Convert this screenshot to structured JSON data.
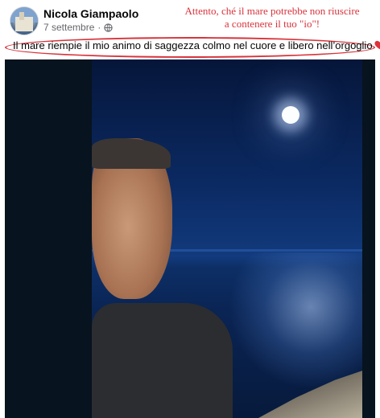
{
  "post": {
    "author": "Nicola Giampaolo",
    "date": "7 settembre",
    "separator": "·",
    "audience_icon": "globe-icon",
    "caption": "Il mare riempie il mio animo di saggezza colmo nel cuore e libero nell’orgoglio",
    "caption_emoji": "heart-icon"
  },
  "annotation": {
    "line1": "Attento, ché il mare potrebbe non riuscire",
    "line2": "a contenere il tuo \"io\"!",
    "color": "#d8343c"
  },
  "photo": {
    "description_icon": "selfie-photo"
  }
}
